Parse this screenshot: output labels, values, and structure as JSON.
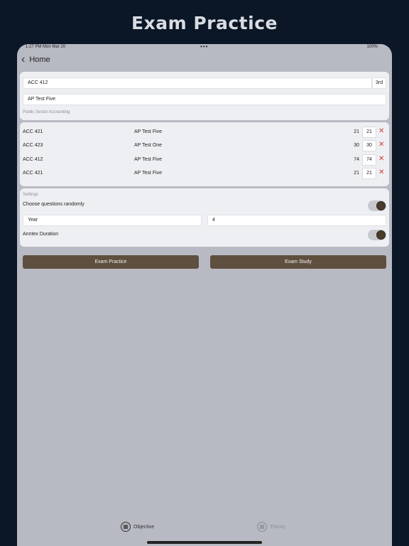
{
  "promo": {
    "title": "Exam Practice"
  },
  "status": {
    "time": "1:27 PM   Mon Mar 20",
    "dots": "•••",
    "right": "100%"
  },
  "nav": {
    "back_label": "Home"
  },
  "course": {
    "code": "ACC 412",
    "level": "3rd",
    "test": "AP Test Five",
    "subject": "Public Sector Accounting"
  },
  "list": [
    {
      "code": "ACC 421",
      "test": "AP Test Five",
      "value": "21",
      "input": "21"
    },
    {
      "code": "ACC 423",
      "test": "AP Test One",
      "value": "30",
      "input": "30"
    },
    {
      "code": "ACC 412",
      "test": "AP Test Five",
      "value": "74",
      "input": "74"
    },
    {
      "code": "ACC 421",
      "test": "AP Test Five",
      "value": "21",
      "input": "21"
    }
  ],
  "settings": {
    "header": "Settings",
    "random_label": "Choose questions randomly",
    "random_on": true,
    "year_field": "Year",
    "count_field": "4",
    "duration_label": "Anntex Duration",
    "duration_on": true
  },
  "buttons": {
    "practice": "Exam Practice",
    "study": "Exam Study"
  },
  "tabs": {
    "objective": "Objective",
    "theory": "Theory"
  },
  "colors": {
    "accent": "#5f4f3f",
    "delete": "#d43b3b",
    "background": "#0b1626"
  }
}
